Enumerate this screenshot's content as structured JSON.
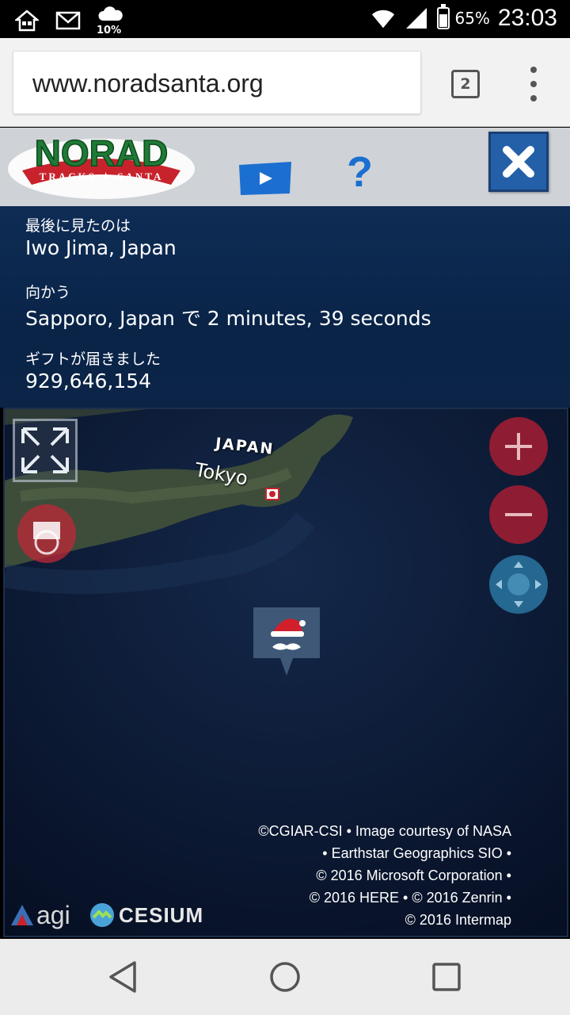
{
  "status_bar": {
    "weather_percent": "10%",
    "battery_percent": "65%",
    "battery_level": 0.65,
    "time": "23:03",
    "icons": [
      "home-icon",
      "mail-icon",
      "weather-icon",
      "wifi-icon",
      "signal-icon",
      "battery-icon"
    ]
  },
  "browser": {
    "url": "www.noradsanta.org",
    "tab_count": "2"
  },
  "header": {
    "logo_alt": "NORAD TRACKS SANTA",
    "help_label": "?"
  },
  "tracker": {
    "last_seen_label": "最後に見たのは",
    "last_seen_value": "Iwo Jima, Japan",
    "heading_label": "向かう",
    "heading_value": "Sapporo, Japan で 2 minutes, 39 seconds",
    "gifts_label": "ギフトが届きました",
    "gifts_value": "929,646,154"
  },
  "map": {
    "country_label": "JAPAN",
    "city_label": "Tokyo",
    "credits": [
      "©CGIAR-CSI • Image courtesy of NASA",
      "• Earthstar Geographics SIO •",
      "© 2016 Microsoft Corporation •",
      "© 2016 HERE • © 2016 Zenrin •",
      "© 2016 Intermap"
    ],
    "agi_logo": "agi",
    "cesium_logo": "CESIUM"
  },
  "colors": {
    "panel_bg": "#0b2447",
    "zoom_btn": "#b41e32",
    "pan_btn": "#2d82af",
    "accent_blue": "#1b6fd0"
  }
}
